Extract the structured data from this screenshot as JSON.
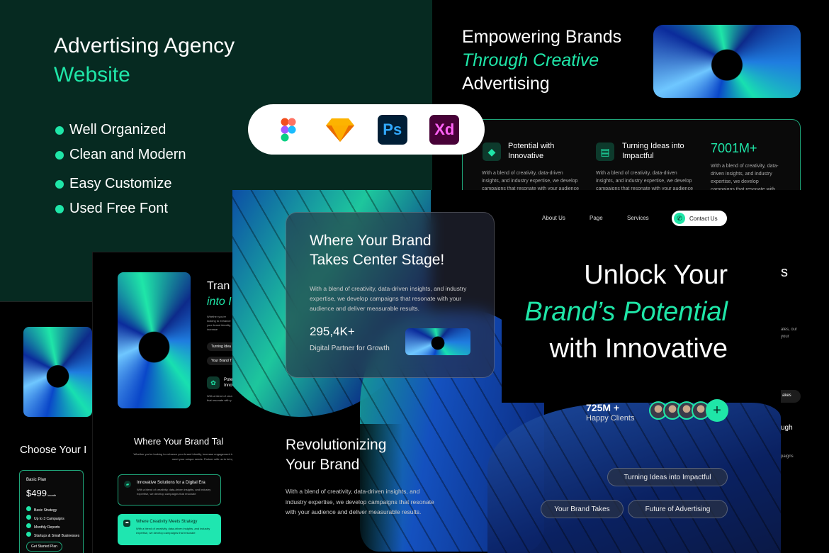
{
  "promo": {
    "title_line1": "Advertising Agency",
    "title_line2": "Website",
    "features": [
      "Well Organized",
      "Clean and Modern",
      "Easy Customize",
      "Used Free Font"
    ],
    "tools": [
      {
        "name": "figma",
        "label": ""
      },
      {
        "name": "sketch",
        "label": ""
      },
      {
        "name": "photoshop",
        "label": "Ps"
      },
      {
        "name": "xd",
        "label": "Xd"
      }
    ]
  },
  "top_preview": {
    "heading_line1": "Empowering Brands",
    "heading_line2": "Through Creative",
    "heading_line3": "Advertising",
    "features": [
      {
        "title": "Potential with Innovative",
        "text": "With a blend of creativity, data-driven insights, and industry expertise, we develop campaigns that resonate with your audience",
        "icon": "diamond-icon"
      },
      {
        "title": "Turning Ideas into Impactful",
        "text": "With a blend of creativity, data-driven insights, and industry expertise, we develop campaigns that resonate with your audience",
        "icon": "clipboard-icon"
      },
      {
        "title": "7001M+",
        "text": "With a blend of creativity, data-driven insights, and industry expertise, we develop campaigns that resonate with your audience"
      }
    ]
  },
  "main": {
    "nav": [
      "About Us",
      "Page",
      "Services"
    ],
    "contact": "Contact Us",
    "card": {
      "title": "Where Your Brand Takes Center Stage!",
      "text": "With a blend of creativity, data-driven insights, and industry expertise, we develop campaigns that resonate with your audience and deliver measurable results.",
      "stat": "295,4K+",
      "stat_label": "Digital Partner for Growth"
    },
    "hero": {
      "line1": "Unlock Your",
      "line2": "Brand’s Potential",
      "line3": "with Innovative"
    },
    "clients": {
      "count": "725M +",
      "label": "Happy Clients",
      "plus": "+"
    },
    "section": {
      "title_line1": "Revolutionizing",
      "title_line2": "Your Brand",
      "text": "With a blend of creativity, data-driven insights, and industry expertise, we develop campaigns that resonate with your audience and deliver measurable results."
    },
    "pills": [
      "Turning Ideas into Impactful",
      "Your Brand Takes",
      "Future of Advertising"
    ],
    "right_peek": {
      "heading": "s",
      "text1": "ales, our",
      "text2": "your",
      "pill": "akes",
      "heading2": "ugh",
      "text3": "paigns"
    }
  },
  "mid_preview": {
    "heading1": "Tran",
    "heading2": "into I",
    "text": "Whether you're looking to enhance your brand identity, increase engagement, we offer tailored solutions on a competitive vision into a compelling",
    "pills": [
      "Turning Idea",
      "Your Brand T"
    ],
    "feature": "Pote Inno",
    "feature_text": "With a blend of creat that resonate with y",
    "section_title": "Where Your Brand Tal",
    "section_text": "Whether you're looking to enhance your brand identity, increase engagement to meet your unique needs. Partner with us to bring",
    "cards": [
      {
        "title": "Innovative Solutions for a Digital Era",
        "text": "With a blend of creativity, data-driven insights, and industry expertise, we develop campaigns that resonate"
      },
      {
        "title": "Where Creativity Meets Strategy",
        "text": "With a blend of creativity, data-driven insights, and industry expertise, we develop campaigns that resonate"
      }
    ]
  },
  "left_preview": {
    "heading": "Choose Your I",
    "plan": {
      "name": "Basic Plan",
      "price": "$499",
      "period": "/ month",
      "items": [
        "Basic Strategy",
        "Up to 3 Campaigns",
        "Monthly Reports",
        "Startups & Small Businesses"
      ],
      "cta": "Get Started Plan"
    }
  },
  "colors": {
    "accent": "#1fe6a8",
    "promo_bg": "#062a21"
  }
}
